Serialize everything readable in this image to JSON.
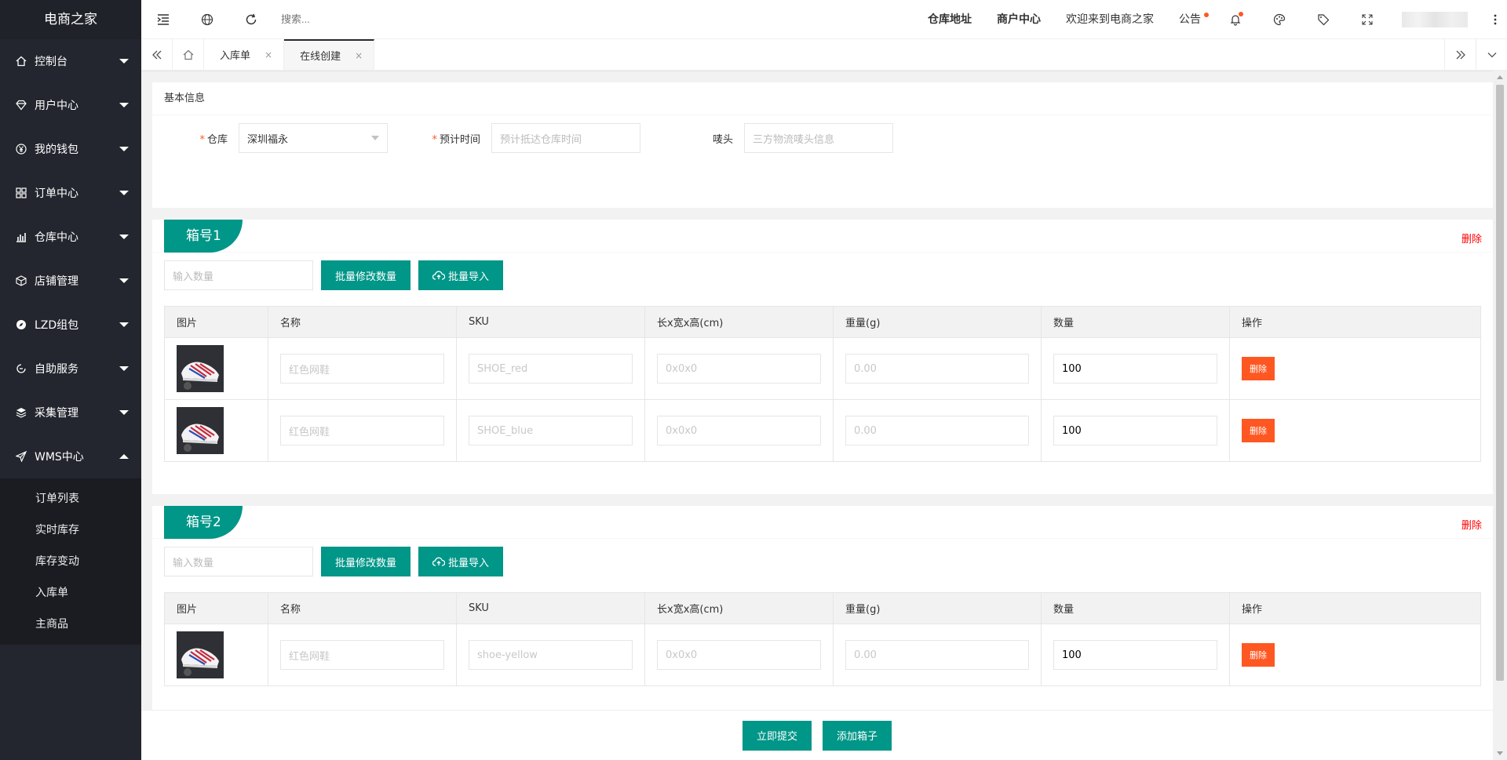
{
  "app": {
    "logo": "电商之家"
  },
  "sidebar": {
    "items": [
      {
        "label": "控制台",
        "icon": "home-icon"
      },
      {
        "label": "用户中心",
        "icon": "diamond-icon"
      },
      {
        "label": "我的钱包",
        "icon": "yen-icon"
      },
      {
        "label": "订单中心",
        "icon": "app-icon"
      },
      {
        "label": "仓库中心",
        "icon": "chart-icon"
      },
      {
        "label": "店铺管理",
        "icon": "cube-icon"
      },
      {
        "label": "LZD组包",
        "icon": "compass-icon"
      },
      {
        "label": "自助服务",
        "icon": "cycle-icon"
      },
      {
        "label": "采集管理",
        "icon": "layers-icon"
      },
      {
        "label": "WMS中心",
        "icon": "send-icon"
      }
    ],
    "sub_items": [
      "订单列表",
      "实时库存",
      "库存变动",
      "入库单",
      "主商品"
    ]
  },
  "header": {
    "search_placeholder": "搜索...",
    "links": [
      "仓库地址",
      "商户中心",
      "欢迎来到电商之家",
      "公告"
    ]
  },
  "tabs": {
    "items": [
      {
        "label": "入库单",
        "close": "×"
      },
      {
        "label": "在线创建",
        "close": "×"
      }
    ]
  },
  "basic": {
    "title": "基本信息",
    "warehouse_label": "仓库",
    "warehouse_value": "深圳福永",
    "time_label": "预计时间",
    "time_placeholder": "预计抵达仓库时间",
    "mark_label": "唛头",
    "mark_placeholder": "三方物流唛头信息",
    "required_mark": "*"
  },
  "boxes": [
    {
      "title": "箱号1",
      "delete_label": "删除",
      "qty_placeholder": "输入数量",
      "batch_qty_label": "批量修改数量",
      "batch_import_label": "批量导入",
      "columns": [
        "图片",
        "名称",
        "SKU",
        "长x宽x高(cm)",
        "重量(g)",
        "数量",
        "操作"
      ],
      "rows": [
        {
          "name_ph": "红色网鞋",
          "sku_ph": "SHOE_red",
          "dim_ph": "0x0x0",
          "weight_ph": "0.00",
          "qty": "100",
          "action": "删除"
        },
        {
          "name_ph": "红色网鞋",
          "sku_ph": "SHOE_blue",
          "dim_ph": "0x0x0",
          "weight_ph": "0.00",
          "qty": "100",
          "action": "删除"
        }
      ]
    },
    {
      "title": "箱号2",
      "delete_label": "删除",
      "qty_placeholder": "输入数量",
      "batch_qty_label": "批量修改数量",
      "batch_import_label": "批量导入",
      "columns": [
        "图片",
        "名称",
        "SKU",
        "长x宽x高(cm)",
        "重量(g)",
        "数量",
        "操作"
      ],
      "rows": [
        {
          "name_ph": "红色网鞋",
          "sku_ph": "shoe-yellow",
          "dim_ph": "0x0x0",
          "weight_ph": "0.00",
          "qty": "100",
          "action": "删除"
        }
      ]
    }
  ],
  "footer": {
    "submit_label": "立即提交",
    "add_box_label": "添加箱子"
  },
  "colors": {
    "primary": "#009688",
    "danger": "#ff5722",
    "sidebar": "#23262e"
  }
}
